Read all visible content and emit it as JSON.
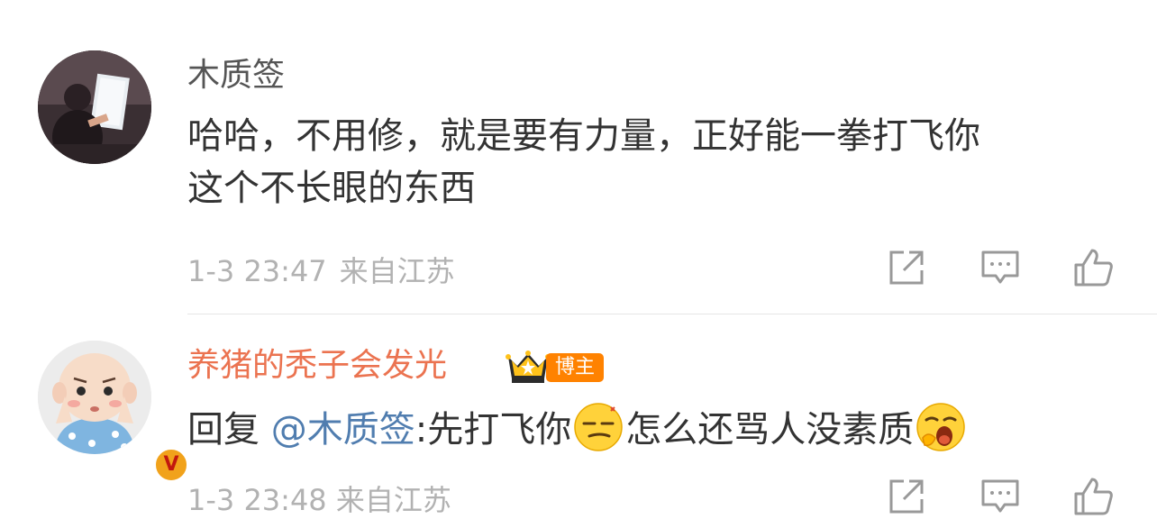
{
  "comments": [
    {
      "username": "木质签",
      "content_lines": [
        "哈哈，不用修，就是要有力量，正好能一拳打飞你",
        "这个不长眼的东西"
      ],
      "time": "1-3 23:47",
      "location": "来自江苏",
      "avatar_icon": "user-avatar-photo",
      "actions": [
        "share-icon",
        "comment-icon",
        "like-icon"
      ]
    },
    {
      "username": "养猪的秃子会发光",
      "badge_label": "博主",
      "verified_label": "V",
      "content_prefix": "回复 ",
      "mention": "@木质签",
      "content_middle": ":先打飞你",
      "content_suffix": "怎么还骂人没素质",
      "emojis": [
        "smirk-emoji",
        "yawn-emoji"
      ],
      "meta_partial": "1-3 23:48 来自江苏",
      "avatar_icon": "cartoon-baby-avatar",
      "actions": [
        "share-icon",
        "comment-icon",
        "like-icon"
      ]
    }
  ],
  "colors": {
    "username_default": "#555555",
    "username_vip": "#eb7350",
    "mention": "#507daf",
    "meta": "#b2b2b2",
    "badge": "#ff8200",
    "text": "#333333"
  }
}
